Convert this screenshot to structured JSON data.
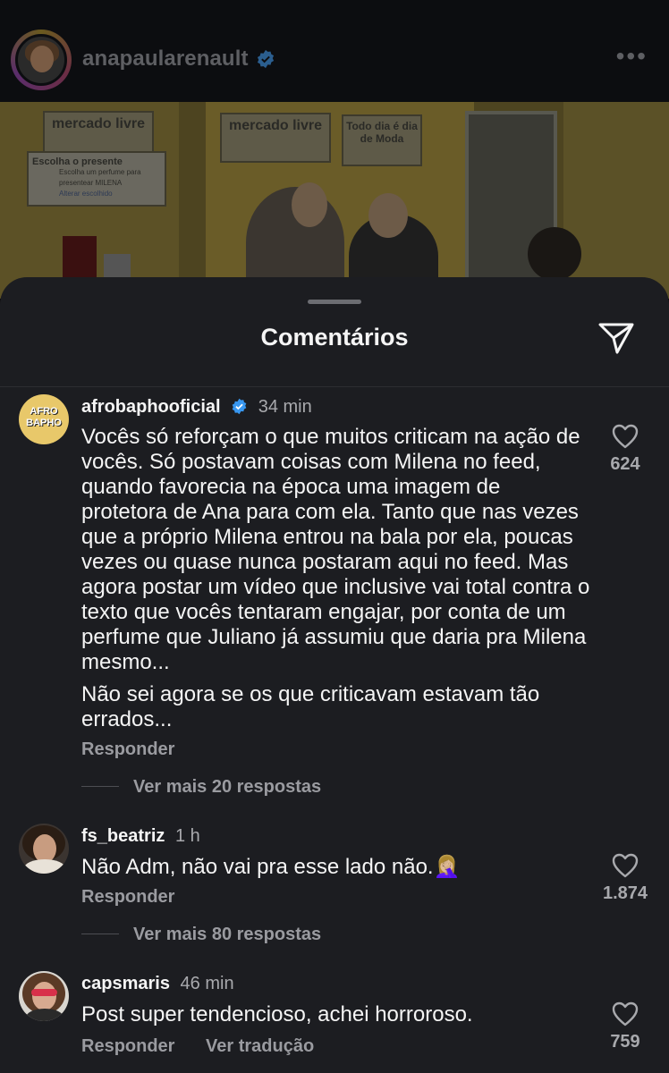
{
  "post": {
    "username": "anapaularenault",
    "media": {
      "brand": "mercado livre",
      "sign_left_title": "Escolha o presente",
      "sign_left_sub": "Escolha um perfume para presentear MILENA",
      "sign_left_link": "Alterar escolhido",
      "sign_right": "Todo dia é dia de Moda"
    }
  },
  "sheet": {
    "title": "Comentários"
  },
  "comments": [
    {
      "username": "afrobaphooficial",
      "verified": true,
      "time": "34 min",
      "avatar_text": "AFRO BAPHO",
      "paragraphs": [
        "Vocês só reforçam o que muitos criticam na ação de vocês. Só postavam coisas com Milena no feed, quando favorecia na época uma imagem de protetora de Ana para com ela. Tanto que nas vezes que a próprio Milena entrou na bala por ela, poucas vezes ou quase nunca postaram aqui no feed. Mas agora postar um vídeo que inclusive vai total contra o texto que vocês tentaram engajar, por conta de um perfume que Juliano já assumiu que daria pra Milena mesmo...",
        "Não sei agora se os que criticavam estavam tão errados..."
      ],
      "reply_label": "Responder",
      "likes": "624",
      "more_replies": "Ver mais 20 respostas"
    },
    {
      "username": "fs_beatriz",
      "verified": false,
      "time": "1 h",
      "text": "Não Adm, não vai pra esse lado não.🤦🏼‍♀️",
      "reply_label": "Responder",
      "likes": "1.874",
      "more_replies": "Ver mais 80 respostas"
    },
    {
      "username": "capsmaris",
      "verified": false,
      "time": "46 min",
      "text": "Post super tendencioso, achei horroroso.",
      "reply_label": "Responder",
      "translate_label": "Ver tradução",
      "likes": "759"
    }
  ],
  "colors": {
    "sheet_bg": "#1c1d21",
    "verified_blue": "#3897f0",
    "secondary_text": "#a8a9ad"
  }
}
